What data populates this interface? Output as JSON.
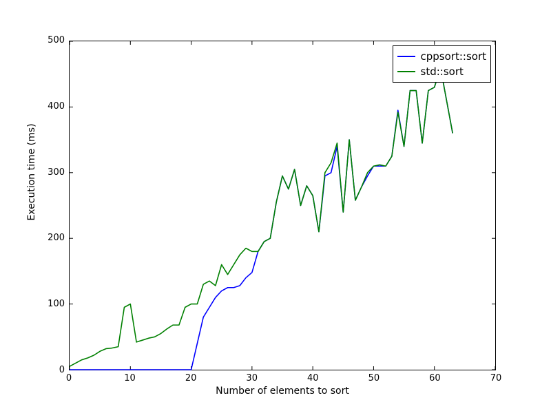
{
  "chart_data": {
    "type": "line",
    "xlabel": "Number of elements to sort",
    "ylabel": "Execution time (ms)",
    "xlim": [
      0,
      70
    ],
    "ylim": [
      0,
      500
    ],
    "xticks": [
      0,
      10,
      20,
      30,
      40,
      50,
      60,
      70
    ],
    "yticks": [
      0,
      100,
      200,
      300,
      400,
      500
    ],
    "legend_position": "upper right",
    "series": [
      {
        "name": "cppsort::sort",
        "color": "#0000ff",
        "x": [
          0,
          1,
          2,
          3,
          4,
          5,
          6,
          7,
          8,
          9,
          10,
          11,
          12,
          13,
          14,
          15,
          16,
          17,
          18,
          19,
          20,
          21,
          22,
          23,
          24,
          25,
          26,
          27,
          28,
          29,
          30,
          31,
          32,
          33,
          34,
          35,
          36,
          37,
          38,
          39,
          40,
          41,
          42,
          43,
          44,
          45,
          46,
          47,
          48,
          49,
          50,
          51,
          52,
          53,
          54,
          55,
          56,
          57,
          58,
          59,
          60,
          61,
          62,
          63
        ],
        "y": [
          0,
          0,
          0,
          0,
          0,
          0,
          0,
          0,
          0,
          0,
          0,
          0,
          0,
          0,
          0,
          0,
          0,
          0,
          0,
          0,
          0,
          40,
          80,
          95,
          110,
          120,
          125,
          125,
          128,
          140,
          148,
          180,
          195,
          200,
          255,
          295,
          275,
          305,
          250,
          280,
          265,
          210,
          295,
          300,
          340,
          240,
          350,
          258,
          278,
          295,
          310,
          310,
          310,
          325,
          395,
          340,
          425,
          425,
          345,
          425,
          430,
          460,
          410,
          360
        ]
      },
      {
        "name": "std::sort",
        "color": "#008000",
        "x": [
          0,
          1,
          2,
          3,
          4,
          5,
          6,
          7,
          8,
          9,
          10,
          11,
          12,
          13,
          14,
          15,
          16,
          17,
          18,
          19,
          20,
          21,
          22,
          23,
          24,
          25,
          26,
          27,
          28,
          29,
          30,
          31,
          32,
          33,
          34,
          35,
          36,
          37,
          38,
          39,
          40,
          41,
          42,
          43,
          44,
          45,
          46,
          47,
          48,
          49,
          50,
          51,
          52,
          53,
          54,
          55,
          56,
          57,
          58,
          59,
          60,
          61,
          62,
          63
        ],
        "y": [
          5,
          10,
          15,
          18,
          22,
          28,
          32,
          33,
          35,
          95,
          100,
          42,
          45,
          48,
          50,
          55,
          62,
          68,
          68,
          95,
          100,
          100,
          130,
          135,
          128,
          160,
          145,
          160,
          175,
          185,
          180,
          180,
          195,
          200,
          255,
          295,
          275,
          305,
          250,
          280,
          265,
          210,
          300,
          315,
          345,
          240,
          350,
          258,
          278,
          300,
          310,
          312,
          310,
          325,
          392,
          340,
          425,
          425,
          345,
          425,
          430,
          460,
          410,
          360
        ]
      }
    ]
  }
}
